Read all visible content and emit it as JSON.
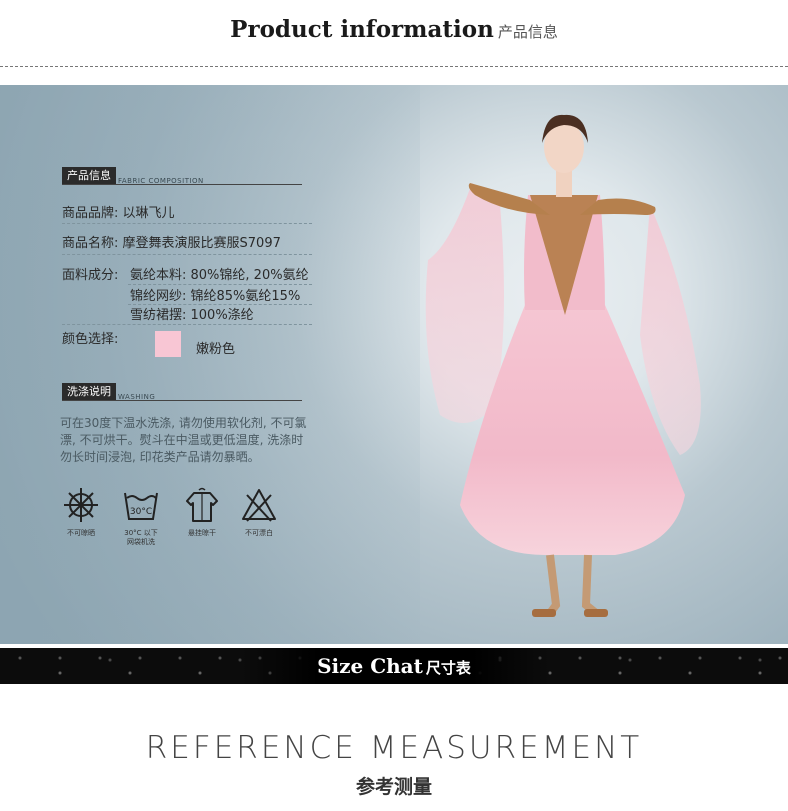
{
  "header": {
    "title_en": "Product  information",
    "title_cn": "产品信息"
  },
  "product_info": {
    "tag": "产品信息",
    "tag_en": "FABRIC COMPOSITION",
    "brand_label": "商品品牌:",
    "brand_value": "以琳飞儿",
    "name_label": "商品名称:",
    "name_value": "摩登舞表演服比赛服S7097",
    "fabric_label": "面料成分:",
    "fabric_lines": [
      "氨纶本料: 80%锦纶, 20%氨纶",
      "锦纶网纱: 锦纶85%氨纶15%",
      "雪纺裙摆: 100%涤纶"
    ],
    "color_label": "颜色选择:",
    "color_name": "嫩粉色",
    "color_swatch": "#f8c6d4"
  },
  "washing": {
    "tag": "洗涤说明",
    "tag_en": "WASHING",
    "text": "可在30度下温水洗涤, 请勿使用软化剂, 不可氯漂, 不可烘干。熨斗在中温或更低温度, 洗涤时勿长时间浸泡, 印花类产品请勿暴晒。",
    "icons": [
      {
        "icon": "no-tumble-dry-icon",
        "label": "不可晾晒"
      },
      {
        "icon": "wash-30-icon",
        "label": "30°C 以下\n网袋机洗",
        "temp": "30°C"
      },
      {
        "icon": "hang-dry-icon",
        "label": "悬挂晾干"
      },
      {
        "icon": "no-bleach-icon",
        "label": "不可漂白"
      }
    ]
  },
  "size_band": {
    "title_en": "Size  Chat",
    "title_cn": "尺寸表"
  },
  "reference": {
    "title_en": "REFERENCE MEASUREMENT",
    "title_cn": "参考测量"
  },
  "colors": {
    "background": "#ffffff",
    "band": "#0c0c0c",
    "hero_blue": "#9fb3be",
    "dress_pink": "#f4c2cf",
    "bodice_gold": "#b0783f"
  }
}
